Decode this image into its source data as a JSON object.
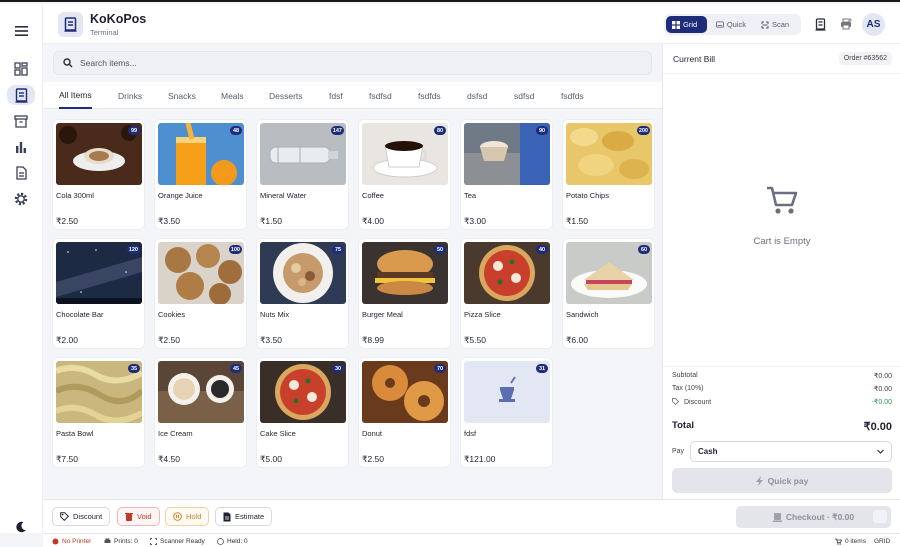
{
  "app": {
    "name": "KoKoPos",
    "subtitle": "Terminal"
  },
  "header": {
    "modes": [
      {
        "label": "Grid",
        "icon": "grid-icon",
        "active": true
      },
      {
        "label": "Quick",
        "icon": "keyboard-icon",
        "active": false
      },
      {
        "label": "Scan",
        "icon": "scan-icon",
        "active": false
      }
    ],
    "avatar_initials": "AS"
  },
  "search": {
    "placeholder": "Search items..."
  },
  "tabs": [
    "All Items",
    "Drinks",
    "Snacks",
    "Meals",
    "Desserts",
    "fdsf",
    "fsdfsd",
    "fsdfds",
    "dsfsd",
    "sdfsd",
    "fsdfds"
  ],
  "active_tab": "All Items",
  "items": [
    {
      "name": "Cola 300ml",
      "price": "₹2.50",
      "stock": "99",
      "image": "coffee-cup-photo"
    },
    {
      "name": "Orange Juice",
      "price": "₹3.50",
      "stock": "48",
      "image": "orange-juice-photo"
    },
    {
      "name": "Mineral Water",
      "price": "₹1.50",
      "stock": "147",
      "image": "water-bottle-photo"
    },
    {
      "name": "Coffee",
      "price": "₹4.00",
      "stock": "80",
      "image": "coffee-photo"
    },
    {
      "name": "Tea",
      "price": "₹3.00",
      "stock": "90",
      "image": "tea-photo"
    },
    {
      "name": "Potato Chips",
      "price": "₹1.50",
      "stock": "200",
      "image": "chips-photo"
    },
    {
      "name": "Chocolate Bar",
      "price": "₹2.00",
      "stock": "120",
      "image": "night-sky-photo"
    },
    {
      "name": "Cookies",
      "price": "₹2.50",
      "stock": "100",
      "image": "cookies-photo"
    },
    {
      "name": "Nuts Mix",
      "price": "₹3.50",
      "stock": "75",
      "image": "nuts-photo"
    },
    {
      "name": "Burger Meal",
      "price": "₹8.99",
      "stock": "50",
      "image": "burger-photo"
    },
    {
      "name": "Pizza Slice",
      "price": "₹5.50",
      "stock": "40",
      "image": "pizza-photo"
    },
    {
      "name": "Sandwich",
      "price": "₹6.00",
      "stock": "60",
      "image": "sandwich-photo"
    },
    {
      "name": "Pasta Bowl",
      "price": "₹7.50",
      "stock": "35",
      "image": "pasta-photo"
    },
    {
      "name": "Ice Cream",
      "price": "₹4.50",
      "stock": "45",
      "image": "ice-cream-photo"
    },
    {
      "name": "Cake Slice",
      "price": "₹5.00",
      "stock": "30",
      "image": "pizza-photo"
    },
    {
      "name": "Donut",
      "price": "₹2.50",
      "stock": "70",
      "image": "donut-photo"
    },
    {
      "name": "fdsf",
      "price": "₹121.00",
      "stock": "31",
      "image": "placeholder-food-icon"
    }
  ],
  "bill": {
    "title": "Current Bill",
    "order": "Order #63562",
    "empty_text": "Cart is Empty",
    "subtotal_label": "Subtotal",
    "subtotal": "₹0.00",
    "tax_label": "Tax (10%)",
    "tax": "₹0.00",
    "discount_label": "Discount",
    "discount": "-₹0.00",
    "total_label": "Total",
    "total": "₹0.00",
    "pay_label": "Pay",
    "pay_method": "Cash",
    "quickpay_label": "Quick pay"
  },
  "toolbar": {
    "discount": "Discount",
    "void": "Void",
    "hold": "Hold",
    "estimate": "Estimate",
    "checkout": "Checkout · ₹0.00"
  },
  "status": {
    "printer": "No Printer",
    "prints": "Prints: 0",
    "scanner": "Scanner Ready",
    "held": "Held: 0",
    "items": "0 items",
    "mode": "GRID"
  },
  "colors": {
    "accent": "#1e2d7a",
    "danger": "#c0392b",
    "warning": "#d0822a",
    "success": "#2e9b4e"
  }
}
